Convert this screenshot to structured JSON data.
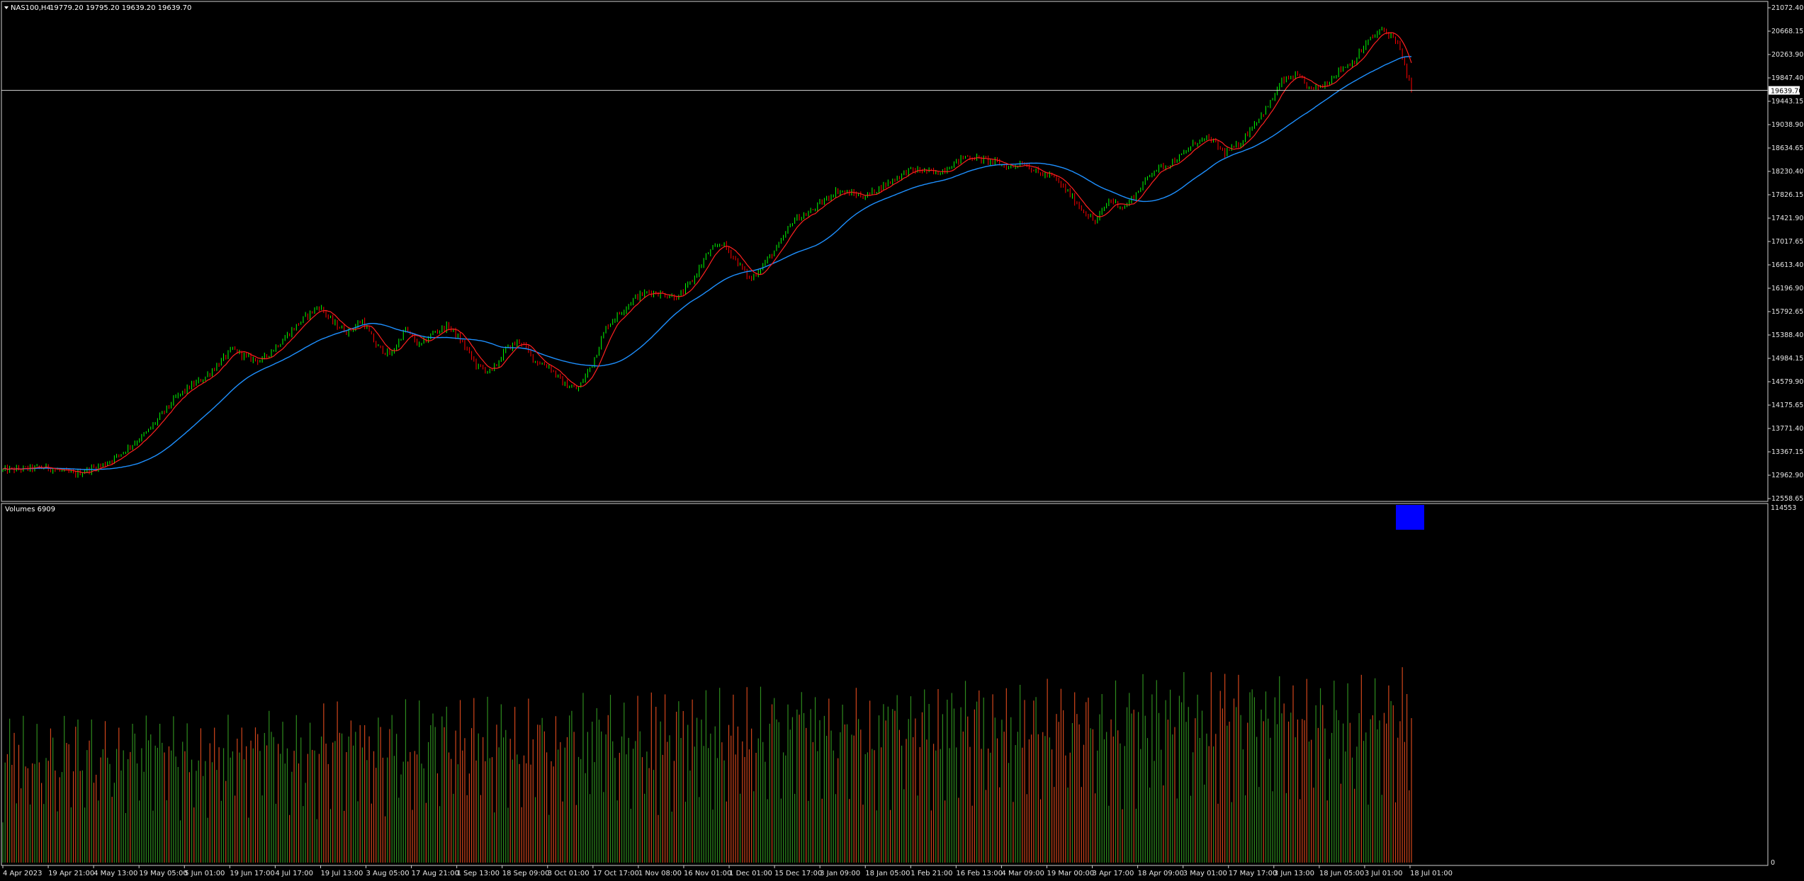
{
  "header": {
    "symbol_label": "NAS100,H4",
    "ohlc_values": "19779.20 19795.20 19639.20 19639.70"
  },
  "volume_panel": {
    "label": "Volumes 6909",
    "top_value": "114553",
    "bottom_value": "0"
  },
  "price_line": {
    "value": "19639.70"
  },
  "colors": {
    "background": "#000000",
    "bull_candle": "#00ff00",
    "bear_candle": "#ff0000",
    "fast_ma": "#ff2020",
    "slow_ma": "#1e90ff",
    "volume_up": "#2e8b1e",
    "volume_down": "#d0451b",
    "volume_marker": "#0000ff",
    "grid_frame": "#cfcfcf"
  },
  "chart_data": {
    "type": "candlestick",
    "price_axis": {
      "ticks": [
        "21072.40",
        "20668.15",
        "20263.90",
        "19847.40",
        "19443.15",
        "19038.90",
        "18634.65",
        "18230.40",
        "17826.15",
        "17421.90",
        "17017.65",
        "16613.40",
        "16196.90",
        "15792.65",
        "15388.40",
        "14984.15",
        "14579.90",
        "14175.65",
        "13771.40",
        "13367.15",
        "12962.90",
        "12558.65"
      ],
      "range": [
        12558.65,
        21072.4
      ]
    },
    "time_axis": {
      "ticks": [
        "4 Apr 2023",
        "19 Apr 21:00",
        "4 May 13:00",
        "19 May 05:00",
        "5 Jun 01:00",
        "19 Jun 17:00",
        "4 Jul 17:00",
        "19 Jul 13:00",
        "3 Aug 05:00",
        "17 Aug 21:00",
        "1 Sep 13:00",
        "18 Sep 09:00",
        "3 Oct 01:00",
        "17 Oct 17:00",
        "1 Nov 08:00",
        "16 Nov 01:00",
        "1 Dec 01:00",
        "15 Dec 17:00",
        "3 Jan 09:00",
        "18 Jan 05:00",
        "1 Feb 21:00",
        "16 Feb 13:00",
        "4 Mar 09:00",
        "19 Mar 00:00",
        "3 Apr 17:00",
        "18 Apr 09:00",
        "3 May 01:00",
        "17 May 17:00",
        "3 Jun 13:00",
        "18 Jun 05:00",
        "3 Jul 01:00",
        "18 Jul 01:00"
      ]
    },
    "close_path": [
      [
        0,
        13050
      ],
      [
        3,
        13100
      ],
      [
        5,
        12980
      ],
      [
        7,
        13150
      ],
      [
        8,
        13300
      ],
      [
        9,
        13500
      ],
      [
        10,
        13700
      ],
      [
        11,
        14000
      ],
      [
        12,
        14300
      ],
      [
        13,
        14500
      ],
      [
        14,
        14650
      ],
      [
        15,
        14900
      ],
      [
        16,
        15150
      ],
      [
        17,
        15000
      ],
      [
        18,
        14950
      ],
      [
        19,
        15200
      ],
      [
        20,
        15450
      ],
      [
        21,
        15700
      ],
      [
        22,
        15900
      ],
      [
        23,
        15600
      ],
      [
        24,
        15450
      ],
      [
        25,
        15650
      ],
      [
        26,
        15200
      ],
      [
        27,
        15050
      ],
      [
        28,
        15500
      ],
      [
        29,
        15200
      ],
      [
        30,
        15450
      ],
      [
        31,
        15550
      ],
      [
        32,
        15250
      ],
      [
        33,
        14850
      ],
      [
        34,
        14750
      ],
      [
        35,
        15150
      ],
      [
        36,
        15300
      ],
      [
        37,
        14950
      ],
      [
        38,
        14850
      ],
      [
        39,
        14550
      ],
      [
        40,
        14450
      ],
      [
        41,
        14900
      ],
      [
        42,
        15550
      ],
      [
        43,
        15800
      ],
      [
        44,
        16050
      ],
      [
        45,
        16150
      ],
      [
        46,
        16100
      ],
      [
        47,
        16050
      ],
      [
        48,
        16350
      ],
      [
        49,
        16800
      ],
      [
        50,
        17000
      ],
      [
        51,
        16700
      ],
      [
        52,
        16350
      ],
      [
        53,
        16650
      ],
      [
        54,
        16950
      ],
      [
        55,
        17400
      ],
      [
        56,
        17500
      ],
      [
        57,
        17700
      ],
      [
        58,
        17900
      ],
      [
        59,
        17850
      ],
      [
        60,
        17800
      ],
      [
        61,
        17950
      ],
      [
        62,
        18100
      ],
      [
        63,
        18250
      ],
      [
        64,
        18250
      ],
      [
        65,
        18200
      ],
      [
        66,
        18350
      ],
      [
        67,
        18500
      ],
      [
        68,
        18450
      ],
      [
        69,
        18400
      ],
      [
        70,
        18300
      ],
      [
        71,
        18400
      ],
      [
        72,
        18200
      ],
      [
        73,
        18150
      ],
      [
        74,
        17900
      ],
      [
        75,
        17600
      ],
      [
        76,
        17350
      ],
      [
        77,
        17750
      ],
      [
        78,
        17600
      ],
      [
        79,
        17900
      ],
      [
        80,
        18250
      ],
      [
        81,
        18350
      ],
      [
        82,
        18500
      ],
      [
        83,
        18750
      ],
      [
        84,
        18800
      ],
      [
        85,
        18550
      ],
      [
        86,
        18700
      ],
      [
        87,
        19050
      ],
      [
        88,
        19350
      ],
      [
        89,
        19800
      ],
      [
        90,
        19900
      ],
      [
        91,
        19650
      ],
      [
        92,
        19750
      ],
      [
        93,
        20000
      ],
      [
        94,
        20150
      ],
      [
        95,
        20500
      ],
      [
        96,
        20700
      ],
      [
        97,
        20500
      ],
      [
        98,
        19639.7
      ]
    ],
    "x_range": [
      0,
      100
    ],
    "fast_ma_label": "",
    "slow_ma_label": "",
    "volume_range": [
      0,
      114553
    ]
  }
}
